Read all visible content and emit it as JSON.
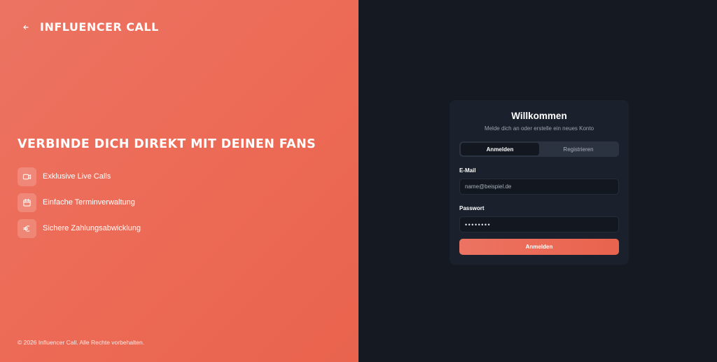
{
  "brand": {
    "name": "INFLUENCER CALL",
    "back_icon": "arrow-left-icon"
  },
  "hero": {
    "headline": "VERBINDE DICH DIREKT MIT DEINEN FANS",
    "features": [
      {
        "icon": "video-icon",
        "label": "Exklusive Live Calls"
      },
      {
        "icon": "calendar-icon",
        "label": "Einfache Terminverwaltung"
      },
      {
        "icon": "euro-icon",
        "label": "Sichere Zahlungsabwicklung"
      }
    ]
  },
  "footer": {
    "copyright": "© 2026 Influencer Call. Alle Rechte vorbehalten."
  },
  "auth": {
    "title": "Willkommen",
    "subtitle": "Melde dich an oder erstelle ein neues Konto",
    "tabs": [
      {
        "label": "Anmelden",
        "active": true
      },
      {
        "label": "Registrieren",
        "active": false
      }
    ],
    "email": {
      "label": "E-Mail",
      "placeholder": "name@beispiel.de",
      "value": ""
    },
    "password": {
      "label": "Passwort",
      "value_masked": "••••••••"
    },
    "submit_label": "Anmelden"
  },
  "colors": {
    "brand_coral": "#ec6a55",
    "panel_dark": "#141922",
    "card_bg": "#1b212c"
  }
}
